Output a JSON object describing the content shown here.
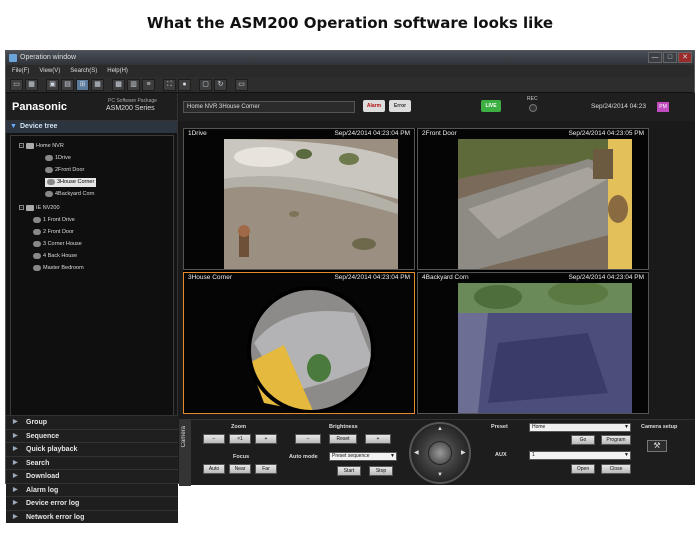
{
  "slide": {
    "title": "What the ASM200 Operation software looks like"
  },
  "window": {
    "title": "Operation window",
    "min": "—",
    "max": "□",
    "close": "✕"
  },
  "menu": [
    "File(F)",
    "View(V)",
    "Search(S)",
    "Help(H)"
  ],
  "brand": {
    "logo": "Panasonic",
    "package_line1": "PC Software Package",
    "package_line2": "ASM200 Series"
  },
  "tree": {
    "header": "Device tree",
    "nodes": [
      {
        "label": "Home NVR",
        "type": "recorder"
      },
      {
        "label": "1Drive",
        "type": "camera"
      },
      {
        "label": "2Front Door",
        "type": "camera"
      },
      {
        "label": "3House Corner",
        "type": "camera",
        "selected": true
      },
      {
        "label": "4Backyard Corn",
        "type": "camera"
      },
      {
        "label": "IE NV200",
        "type": "recorder"
      },
      {
        "label": "1 Front Drive",
        "type": "camera"
      },
      {
        "label": "2 Front Door",
        "type": "camera"
      },
      {
        "label": "3 Corner House",
        "type": "camera"
      },
      {
        "label": "4 Back House",
        "type": "camera"
      },
      {
        "label": "Master Bedroom",
        "type": "camera"
      }
    ]
  },
  "sections": [
    "Group",
    "Sequence",
    "Quick playback",
    "Search",
    "Download",
    "Alarm log",
    "Device error log",
    "Network error log"
  ],
  "status": {
    "path": "Home NVR 3House Corner",
    "alarm": "Alarm",
    "error": "Error",
    "live": "LIVE",
    "rec": "REC",
    "datetime": "Sep/24/2014 04:23",
    "ampm": "PM"
  },
  "tiles": [
    {
      "label": "1Drive",
      "timestamp": "Sep/24/2014 04:23:04 PM",
      "active": false
    },
    {
      "label": "2Front Door",
      "timestamp": "Sep/24/2014 04:23:05 PM",
      "active": false
    },
    {
      "label": "3House Corner",
      "timestamp": "Sep/24/2014 04:23:04 PM",
      "active": true
    },
    {
      "label": "4Backyard Corn",
      "timestamp": "Sep/24/2014 04:23:04 PM",
      "active": false
    }
  ],
  "controls": {
    "tab": "Camera",
    "zoom": {
      "label": "Zoom",
      "minus": "−",
      "x1": "×1",
      "plus": "+"
    },
    "focus": {
      "label": "Focus",
      "auto": "Auto",
      "near": "Near",
      "far": "Far"
    },
    "brightness": {
      "label": "Brightness",
      "minus": "−",
      "reset": "Reset",
      "plus": "+"
    },
    "auto_mode": {
      "label": "Auto mode",
      "value": "Preset sequence",
      "start": "Start",
      "stop": "Stop"
    },
    "preset": {
      "label": "Preset",
      "value": "Home",
      "go": "Go",
      "program": "Program"
    },
    "aux": {
      "label": "AUX",
      "value": "1",
      "open": "Open",
      "close": "Close"
    },
    "camera_setup": {
      "label": "Camera setup"
    }
  },
  "colors": {
    "active_border": "#e38a2c",
    "live": "#3cb043",
    "ampm": "#c04cc0"
  }
}
